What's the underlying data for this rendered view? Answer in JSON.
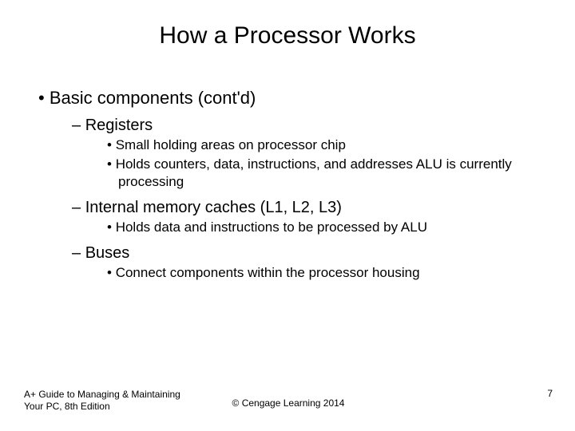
{
  "title": "How a Processor Works",
  "bullets": {
    "l1": "Basic components (cont'd)",
    "l2a": "Registers",
    "l3a1": "Small holding areas on processor chip",
    "l3a2": "Holds counters, data, instructions, and addresses ALU is currently processing",
    "l2b": "Internal memory caches (L1, L2, L3)",
    "l3b1": "Holds data and instructions to be processed by ALU",
    "l2c": "Buses",
    "l3c1": "Connect components within the processor housing"
  },
  "footer": {
    "left_line1": "A+ Guide to Managing & Maintaining",
    "left_line2": "Your PC, 8th Edition",
    "center": "© Cengage Learning 2014",
    "page": "7"
  }
}
